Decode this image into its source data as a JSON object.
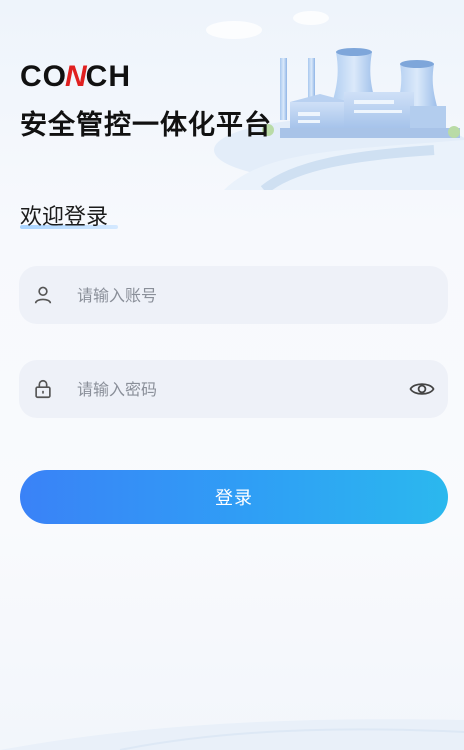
{
  "brand": {
    "logo_left": "CO",
    "logo_slash": "N",
    "logo_right": "CH"
  },
  "header": {
    "app_title": "安全管控一体化平台"
  },
  "login": {
    "welcome_text": "欢迎登录",
    "account_placeholder": "请输入账号",
    "password_placeholder": "请输入密码",
    "submit_label": "登录"
  },
  "icons": {
    "account": "user-icon",
    "password": "lock-icon",
    "toggle": "eye-icon"
  },
  "colors": {
    "accent_start": "#3a82f7",
    "accent_end": "#2bb8ee",
    "field_bg": "#eef1f8",
    "logo_red": "#e02020"
  }
}
